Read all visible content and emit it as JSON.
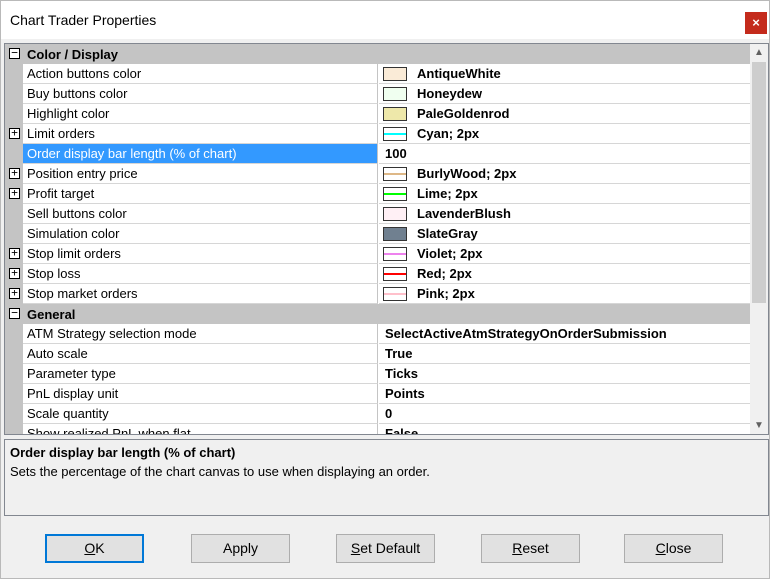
{
  "window": {
    "title": "Chart Trader Properties",
    "close_glyph": "×"
  },
  "grid": {
    "categories": [
      {
        "label": "Color / Display",
        "expander": "⊟",
        "rows": [
          {
            "name": "Action buttons color",
            "value": "AntiqueWhite",
            "swatch": "fill",
            "color": "#FAEBD7"
          },
          {
            "name": "Buy buttons color",
            "value": "Honeydew",
            "swatch": "fill",
            "color": "#F0FFF0"
          },
          {
            "name": "Highlight color",
            "value": "PaleGoldenrod",
            "swatch": "fill",
            "color": "#EEE8AA"
          },
          {
            "name": "Limit orders",
            "value": "Cyan; 2px",
            "swatch": "line",
            "color": "#00FFFF",
            "expandable": true
          },
          {
            "name": "Order display bar length (% of chart)",
            "value": "100",
            "selected": true
          },
          {
            "name": "Position entry price",
            "value": "BurlyWood; 2px",
            "swatch": "line",
            "color": "#DEB887",
            "expandable": true
          },
          {
            "name": "Profit target",
            "value": "Lime; 2px",
            "swatch": "line",
            "color": "#00FF00",
            "expandable": true
          },
          {
            "name": "Sell buttons color",
            "value": "LavenderBlush",
            "swatch": "fill",
            "color": "#FFF0F5"
          },
          {
            "name": "Simulation color",
            "value": "SlateGray",
            "swatch": "fill",
            "color": "#708090"
          },
          {
            "name": "Stop limit orders",
            "value": "Violet; 2px",
            "swatch": "line",
            "color": "#EE82EE",
            "expandable": true
          },
          {
            "name": "Stop loss",
            "value": "Red; 2px",
            "swatch": "line",
            "color": "#FF0000",
            "expandable": true
          },
          {
            "name": "Stop market orders",
            "value": "Pink; 2px",
            "swatch": "line",
            "color": "#FFC0CB",
            "expandable": true
          }
        ]
      },
      {
        "label": "General",
        "expander": "⊟",
        "rows": [
          {
            "name": "ATM Strategy selection mode",
            "value": "SelectActiveAtmStrategyOnOrderSubmission"
          },
          {
            "name": "Auto scale",
            "value": "True"
          },
          {
            "name": "Parameter type",
            "value": "Ticks"
          },
          {
            "name": "PnL display unit",
            "value": "Points"
          },
          {
            "name": "Scale quantity",
            "value": "0"
          },
          {
            "name": "Show realized PnL when flat",
            "value": "False"
          }
        ]
      }
    ],
    "expand_glyph": "+",
    "scroll_up_glyph": "▲",
    "scroll_down_glyph": "▼",
    "scroll_fraction_visible": 0.68
  },
  "description": {
    "title": "Order display bar length (% of chart)",
    "text": "Sets the percentage of the chart canvas to use when displaying an order."
  },
  "buttons": [
    {
      "key": "ok",
      "label": "OK",
      "mnemonic_index": 0,
      "default": true
    },
    {
      "key": "apply",
      "label": "Apply",
      "mnemonic_index": -1
    },
    {
      "key": "set-default",
      "label": "Set Default",
      "mnemonic_index": 0
    },
    {
      "key": "reset",
      "label": "Reset",
      "mnemonic_index": 0
    },
    {
      "key": "close",
      "label": "Close",
      "mnemonic_index": 0
    }
  ],
  "colors": {
    "selection": "#3399FF",
    "category_band": "#C4C4C4",
    "close_button": "#C42B1C",
    "default_button_border": "#0078D7"
  }
}
